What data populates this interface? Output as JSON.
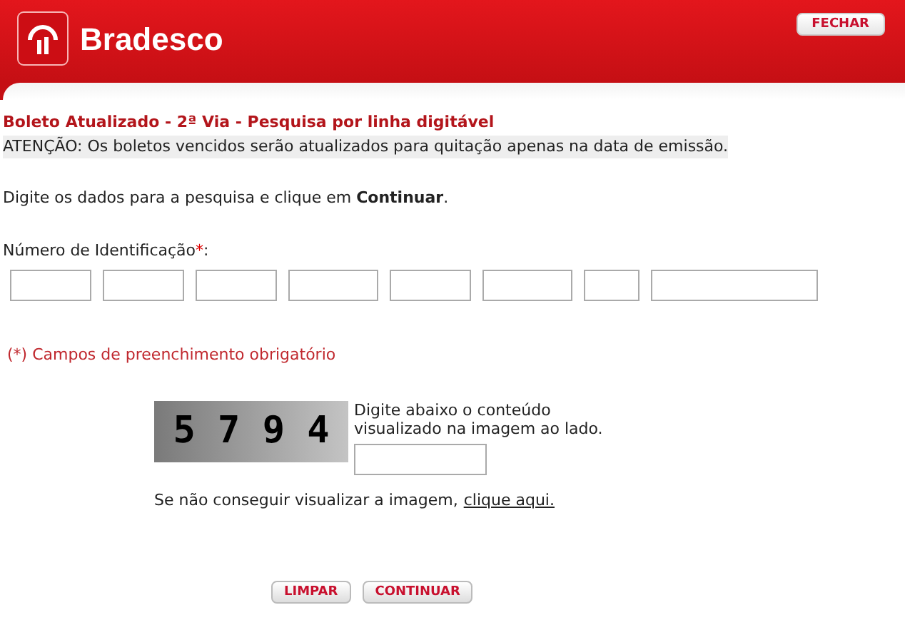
{
  "header": {
    "logo_text": "Bradesco",
    "close_button": "FECHAR"
  },
  "title": "Boleto Atualizado - 2ª Via - Pesquisa por linha digitável",
  "notice": "ATENÇÃO: Os boletos vencidos serão atualizados para quitação apenas na data de emissão.",
  "instruction": "Digite os dados para a pesquisa e clique em **Continuar**.",
  "id_label": "Número de Identificação",
  "required_mark": "*",
  "label_suffix": ":",
  "id_fields": [
    {
      "kind": "medium"
    },
    {
      "kind": "medium"
    },
    {
      "kind": "medium"
    },
    {
      "kind": "wide"
    },
    {
      "kind": "medium"
    },
    {
      "kind": "wide"
    },
    {
      "kind": "short"
    },
    {
      "kind": "long"
    }
  ],
  "required_note": "(*) Campos de preenchimento obrigatório",
  "captcha": {
    "code": "5 7 9 4",
    "prompt": "Digite abaixo o conteúdo visualizado na imagem ao lado.",
    "help": "Se não conseguir visualizar a imagem,",
    "link": "clique aqui."
  },
  "buttons": [
    "LIMPAR",
    "CONTINUAR"
  ]
}
